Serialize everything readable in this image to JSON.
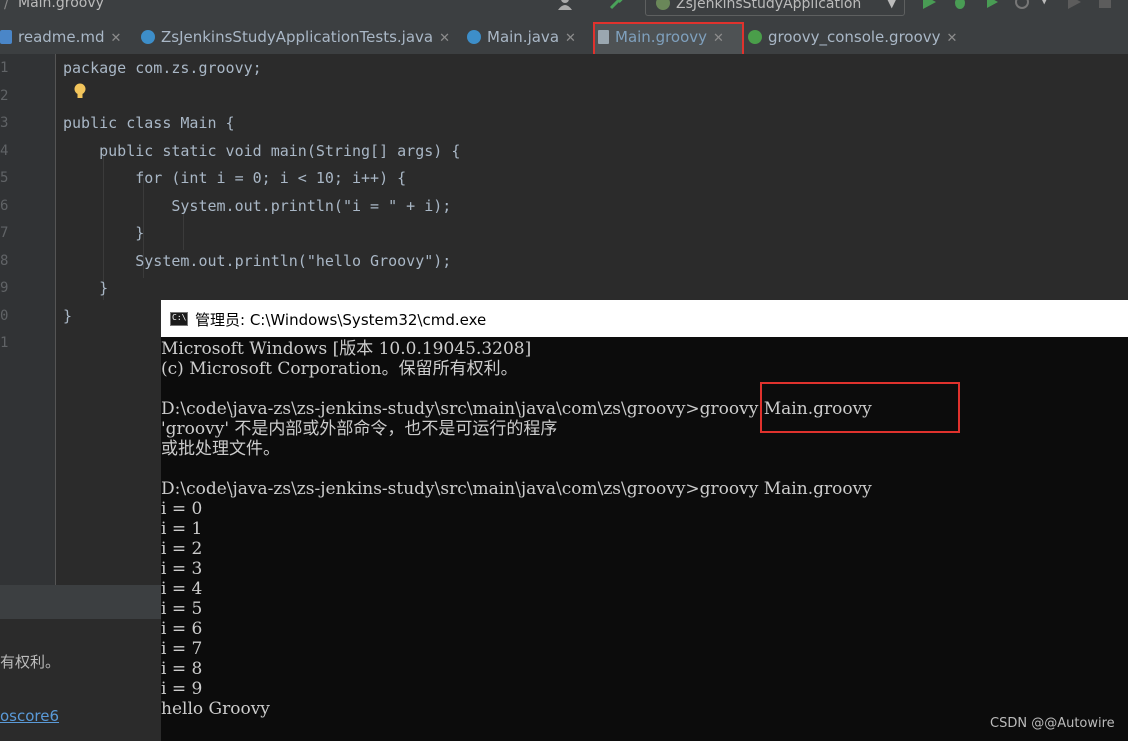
{
  "toolbar": {
    "file_crumb": "Main.groovy",
    "run_config": "ZsJenkinsStudyApplication"
  },
  "tabs": [
    {
      "label": "readme.md",
      "icon": "markdown-icon",
      "color": "#4a86c8"
    },
    {
      "label": "ZsJenkinsStudyApplicationTests.java",
      "icon": "java-class-icon",
      "color": "#3d8ec9"
    },
    {
      "label": "Main.java",
      "icon": "java-class-icon",
      "color": "#3d8ec9"
    },
    {
      "label": "Main.groovy",
      "icon": "groovy-file-icon",
      "color": "#9aa7b0"
    },
    {
      "label": "groovy_console.groovy",
      "icon": "groovy-icon",
      "color": "#4a9e4a"
    }
  ],
  "editor": {
    "line_numbers": [
      "1",
      "2",
      "3",
      "4",
      "5",
      "6",
      "7",
      "8",
      "9",
      "0",
      "1"
    ],
    "lines": [
      "package com.zs.groovy;",
      "",
      "public class Main {",
      "    public static void main(String[] args) {",
      "        for (int i = 0; i < 10; i++) {",
      "            System.out.println(\"i = \" + i);",
      "        }",
      "        System.out.println(\"hello Groovy\");",
      "    }",
      "}",
      ""
    ]
  },
  "lower_panel": {
    "message": "有权利。",
    "link": "oscore6"
  },
  "cmd": {
    "title": "管理员: C:\\Windows\\System32\\cmd.exe",
    "lines": [
      "Microsoft Windows [版本 10.0.19045.3208]",
      "(c) Microsoft Corporation。保留所有权利。",
      "",
      "D:\\code\\java-zs\\zs-jenkins-study\\src\\main\\java\\com\\zs\\groovy>groovy Main.groovy",
      "'groovy' 不是内部或外部命令，也不是可运行的程序",
      "或批处理文件。",
      "",
      "D:\\code\\java-zs\\zs-jenkins-study\\src\\main\\java\\com\\zs\\groovy>groovy Main.groovy",
      "i = 0",
      "i = 1",
      "i = 2",
      "i = 3",
      "i = 4",
      "i = 5",
      "i = 6",
      "i = 7",
      "i = 8",
      "i = 9",
      "hello Groovy"
    ]
  },
  "watermark": "CSDN @@Autowire",
  "colors": {
    "highlight_box": "#e0322d",
    "editor_bg": "#2b2b2b",
    "cmd_bg": "#0c0c0c"
  }
}
